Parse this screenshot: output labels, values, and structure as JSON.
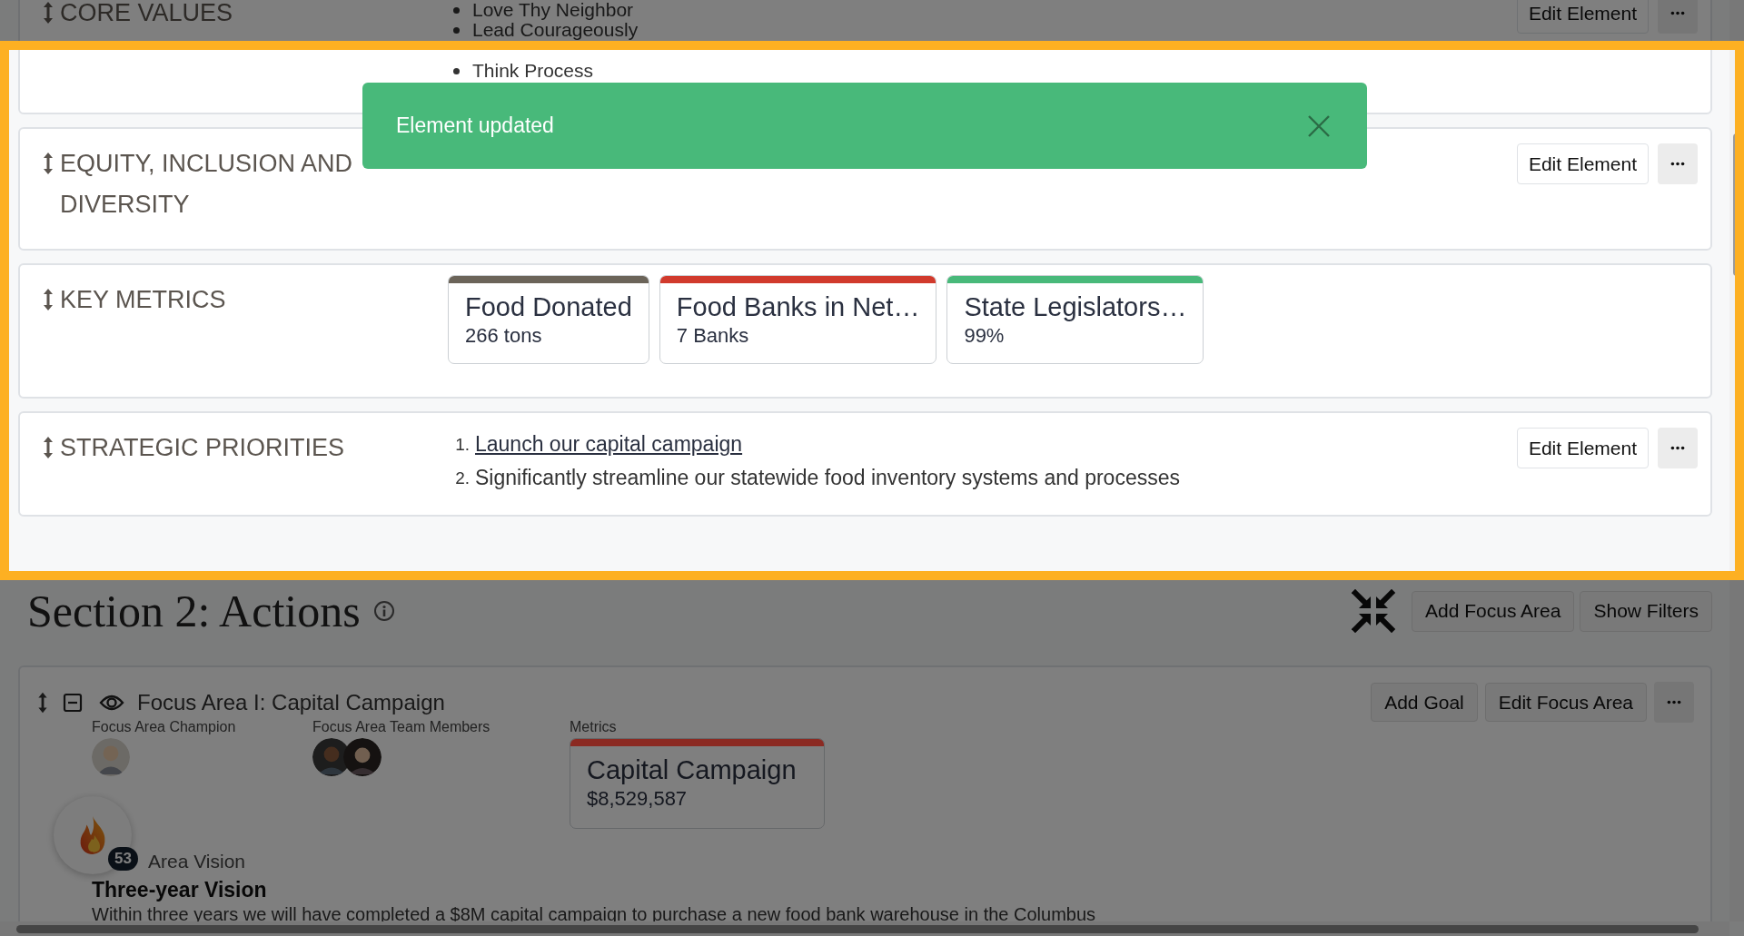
{
  "elements": [
    {
      "kind": "bullets",
      "title": "CORE VALUES",
      "items": [
        "Love Thy Neighbor",
        "Lead Courageously",
        "Think Process"
      ],
      "edit": "Edit Element"
    },
    {
      "kind": "link",
      "title": "EQUITY, INCLUSION AND DIVERSITY",
      "edit": "Edit Element"
    },
    {
      "kind": "metrics",
      "title": "KEY METRICS",
      "metrics": [
        {
          "title": "Food Donated",
          "value": "266 tons",
          "color": "#6b6459"
        },
        {
          "title": "Food Banks in Net…",
          "value": "7 Banks",
          "color": "#d13a2c"
        },
        {
          "title": "State Legislators…",
          "value": "99%",
          "color": "#48b97a"
        }
      ]
    },
    {
      "kind": "numbered",
      "title": "STRATEGIC PRIORITIES",
      "items": [
        {
          "number": "1.",
          "text": "Launch our capital campaign",
          "link": true
        },
        {
          "number": "2.",
          "text": "Significantly streamline our statewide food inventory systems and processes",
          "link": false
        }
      ],
      "edit": "Edit Element"
    }
  ],
  "toast": {
    "message": "Element updated"
  },
  "section2": {
    "title": "Section 2: Actions",
    "buttons": [
      "Add Focus Area",
      "Show Filters"
    ],
    "focus_area": {
      "title": "Focus Area I: Capital Campaign",
      "buttons": [
        "Add Goal",
        "Edit Focus Area"
      ],
      "champion_label": "Focus Area Champion",
      "team_label": "Focus Area Team Members",
      "metrics_label": "Metrics",
      "metric": {
        "title": "Capital Campaign",
        "value": "$8,529,587",
        "color": "#8b2a22"
      },
      "badge_count": "53",
      "vision_label": "Area Vision",
      "vision_title": "Three-year Vision",
      "vision_text": "Within three years we will have completed a $8M capital campaign to purchase a new food bank warehouse in the Columbus"
    }
  }
}
